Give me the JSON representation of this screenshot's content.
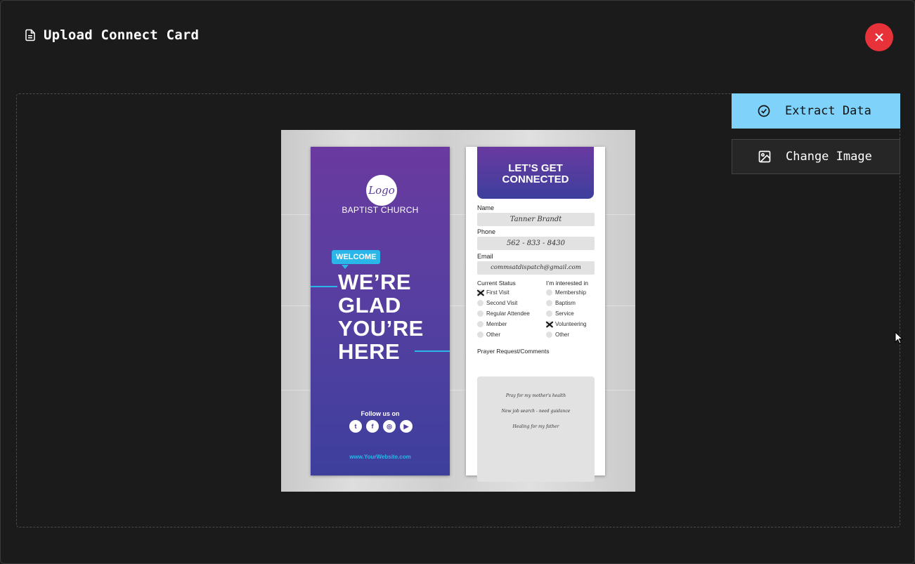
{
  "header": {
    "title": "Upload Connect Card",
    "icon": "document-icon"
  },
  "close_button": {
    "icon": "close-icon",
    "color": "#e8323a"
  },
  "actions": {
    "extract_label": "Extract Data",
    "extract_icon": "check-circle-icon",
    "change_label": "Change Image",
    "change_icon": "image-icon",
    "accent": "#7fd3fb"
  },
  "card_front": {
    "logo": "Logo",
    "church": "BAPTIST CHURCH",
    "welcome": "WELCOME",
    "headline": [
      "WE’RE",
      "GLAD",
      "YOU’RE",
      "HERE"
    ],
    "follow": "Follow us on",
    "social_icons": [
      "twitter-icon",
      "facebook-icon",
      "instagram-icon",
      "youtube-icon"
    ],
    "website": "www.YourWebsite.com"
  },
  "card_back": {
    "heading": [
      "LET’S GET",
      "CONNECTED"
    ],
    "name_label": "Name",
    "name_value": "Tanner Brandt",
    "phone_label": "Phone",
    "phone_value": "562 - 833 - 8430",
    "email_label": "Email",
    "email_value": "commsatdispatch@gmail.com",
    "status_label": "Current Status",
    "status_options": [
      {
        "label": "First Visit",
        "checked": true
      },
      {
        "label": "Second Visit",
        "checked": false
      },
      {
        "label": "Regular Attendee",
        "checked": false
      },
      {
        "label": "Member",
        "checked": false
      },
      {
        "label": "Other",
        "checked": false
      }
    ],
    "interest_label": "I’m interested in",
    "interest_options": [
      {
        "label": "Membership",
        "checked": false
      },
      {
        "label": "Baptism",
        "checked": false
      },
      {
        "label": "Service",
        "checked": false
      },
      {
        "label": "Volunteering",
        "checked": true
      },
      {
        "label": "Other",
        "checked": false
      }
    ],
    "prayer_label": "Prayer Request/Comments",
    "prayer_lines": [
      "Pray for my mother's health",
      "New job search - need guidance",
      "Healing for my father"
    ]
  }
}
